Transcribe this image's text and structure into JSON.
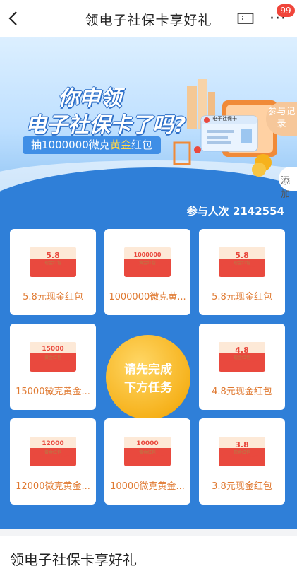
{
  "nav": {
    "title": "领电子社保卡享好礼",
    "badge": "99"
  },
  "banner": {
    "headline_line1": "你申领",
    "headline_line2": "电子社保卡了吗?",
    "subhead_prefix": "抽1000000微克",
    "subhead_gold": "黄金",
    "subhead_suffix": "红包",
    "side_tab": "参与记录",
    "add_tab": "添加",
    "card_title": "电子社保卡"
  },
  "participants": {
    "label": "参与人次",
    "count": "2142554"
  },
  "prizes": [
    {
      "amount": "5.8",
      "unit": "元",
      "env_sub": "现金红包",
      "label": "5.8元现金红包"
    },
    {
      "amount": "1000000",
      "unit": "微克",
      "env_sub": "黄金红包",
      "label": "1000000微克黄..."
    },
    {
      "amount": "5.8",
      "unit": "元",
      "env_sub": "现金红包",
      "label": "5.8元现金红包"
    },
    {
      "amount": "15000",
      "unit": "微克",
      "env_sub": "黄金红包",
      "label": "15000微克黄金..."
    },
    {
      "amount": "4.8",
      "unit": "元",
      "env_sub": "现金红包",
      "label": "4.8元现金红包"
    },
    {
      "amount": "12000",
      "unit": "微克",
      "env_sub": "黄金红包",
      "label": "12000微克黄金..."
    },
    {
      "amount": "10000",
      "unit": "微克",
      "env_sub": "黄金红包",
      "label": "10000微克黄金..."
    },
    {
      "amount": "3.8",
      "unit": "元",
      "env_sub": "现金红包",
      "label": "3.8元现金红包"
    }
  ],
  "center_button": {
    "line1": "请先完成",
    "line2": "下方任务"
  },
  "section_title": "领电子社保卡享好礼",
  "colors": {
    "brand_blue": "#2f7fd8",
    "prize_red": "#e9493e",
    "label_orange": "#e07a32",
    "gold": "#f6b21c"
  }
}
